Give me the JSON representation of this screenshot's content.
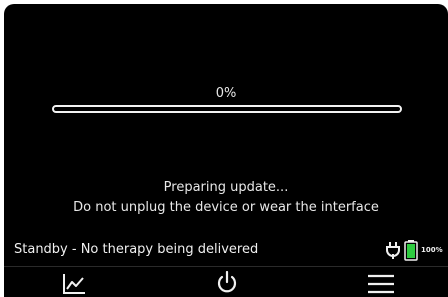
{
  "update": {
    "progress_text": "0%",
    "progress_value": 0,
    "message_line1": "Preparing update...",
    "message_line2": "Do not unplug the device or wear the interface"
  },
  "status": {
    "text": "Standby - No therapy being delivered",
    "battery_percent": "100%",
    "battery_level": 1.0,
    "power_icon": "plug-icon",
    "battery_color": "#2ecc40"
  },
  "nav": {
    "items": [
      {
        "icon": "chart-icon"
      },
      {
        "icon": "power-icon"
      },
      {
        "icon": "menu-icon"
      }
    ]
  },
  "colors": {
    "screen_bg": "#000000",
    "foreground": "#f2f2f2",
    "accent_battery": "#2ecc40"
  }
}
